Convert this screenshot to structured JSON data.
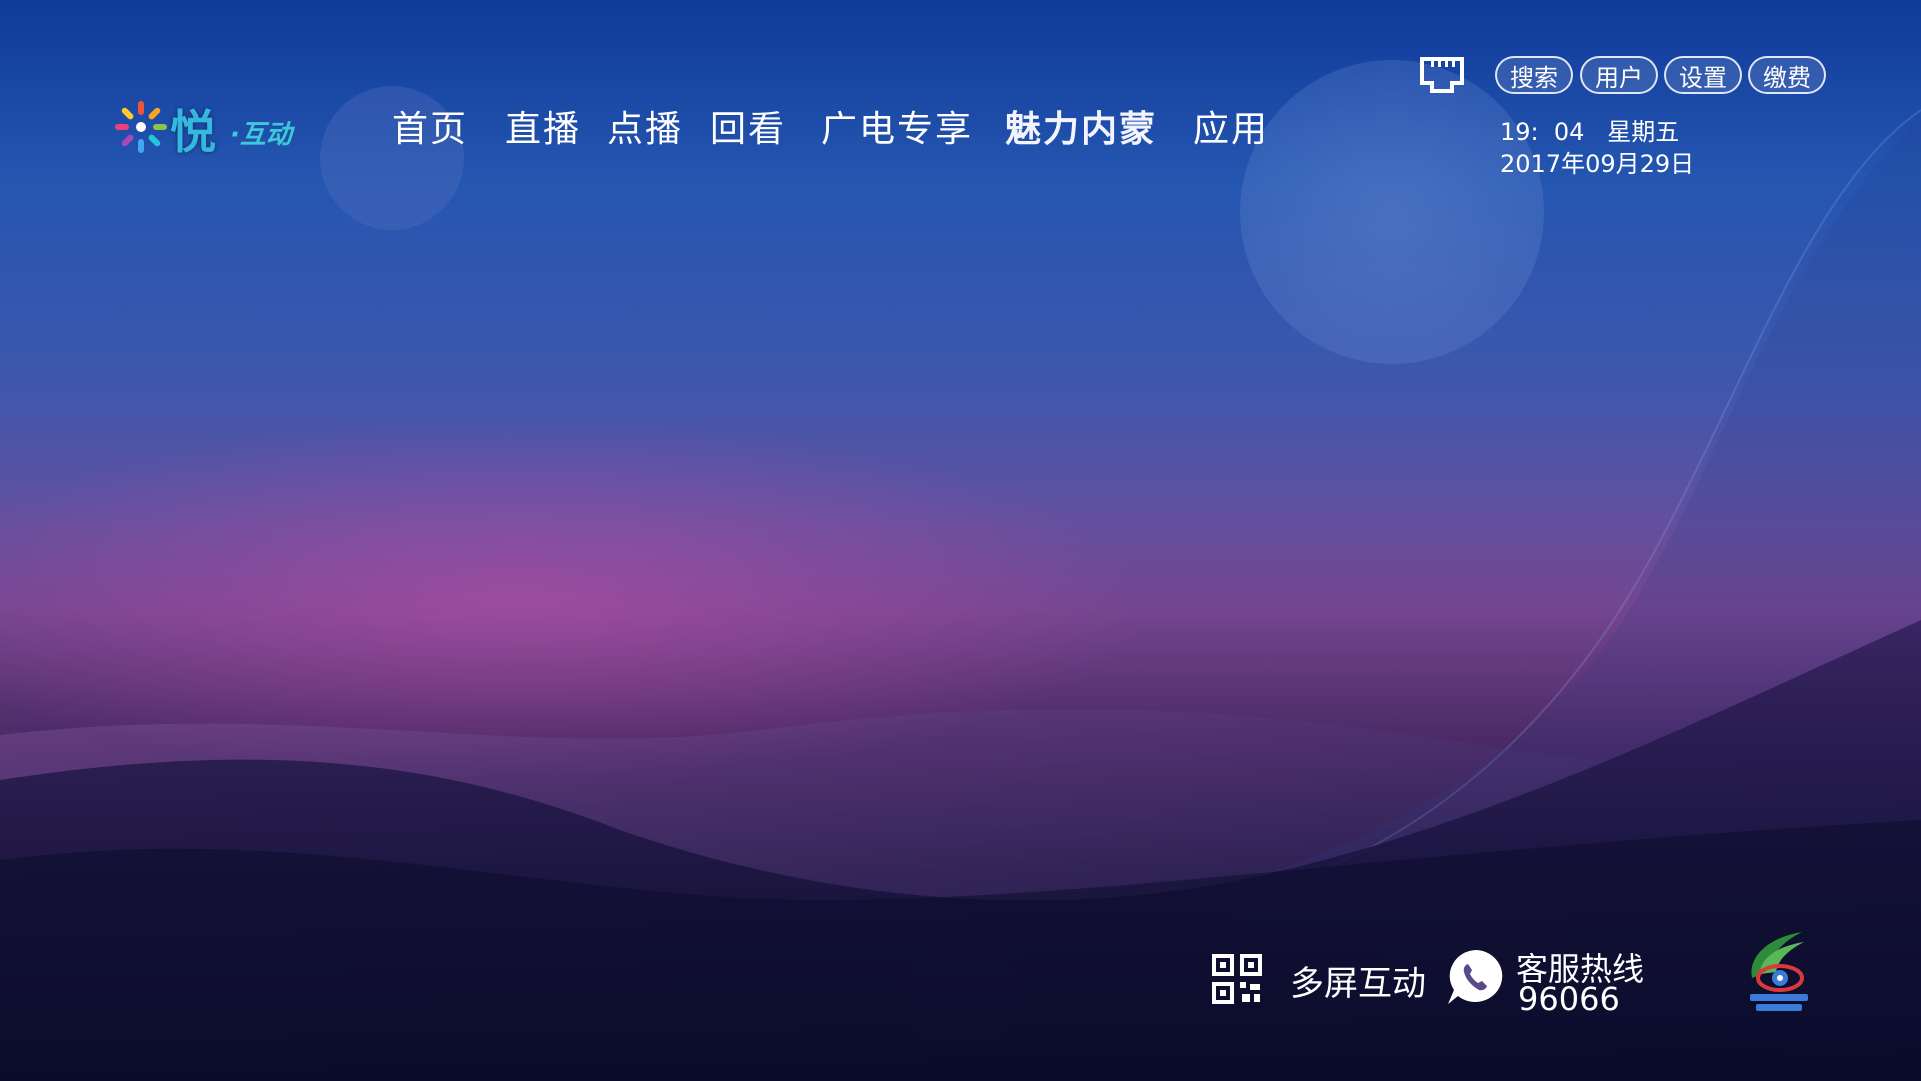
{
  "app": {
    "logo_main": "悦",
    "logo_sub": "·互动"
  },
  "nav": {
    "items": [
      {
        "label": "首页"
      },
      {
        "label": "直播"
      },
      {
        "label": "点播"
      },
      {
        "label": "回看"
      },
      {
        "label": "广电专享"
      },
      {
        "label": "魅力内蒙",
        "active": true
      },
      {
        "label": "应用"
      }
    ]
  },
  "top_right": {
    "network_icon": "network-port-icon",
    "buttons": [
      {
        "label": "搜索"
      },
      {
        "label": "用户"
      },
      {
        "label": "设置"
      },
      {
        "label": "缴费"
      }
    ],
    "time": "19:  04   星期五",
    "date": "2017年09月29日"
  },
  "bottom": {
    "qr_icon": "qr-code-icon",
    "multiscreen_label": "多屏互动",
    "phone_icon": "phone-icon",
    "hotline_label": "客服热线",
    "hotline_number": "96066"
  },
  "colors": {
    "background_top": "#0f3a9a",
    "background_mid": "#74458f",
    "background_bottom": "#0a0b2a",
    "pill_border": "#ffffff"
  }
}
